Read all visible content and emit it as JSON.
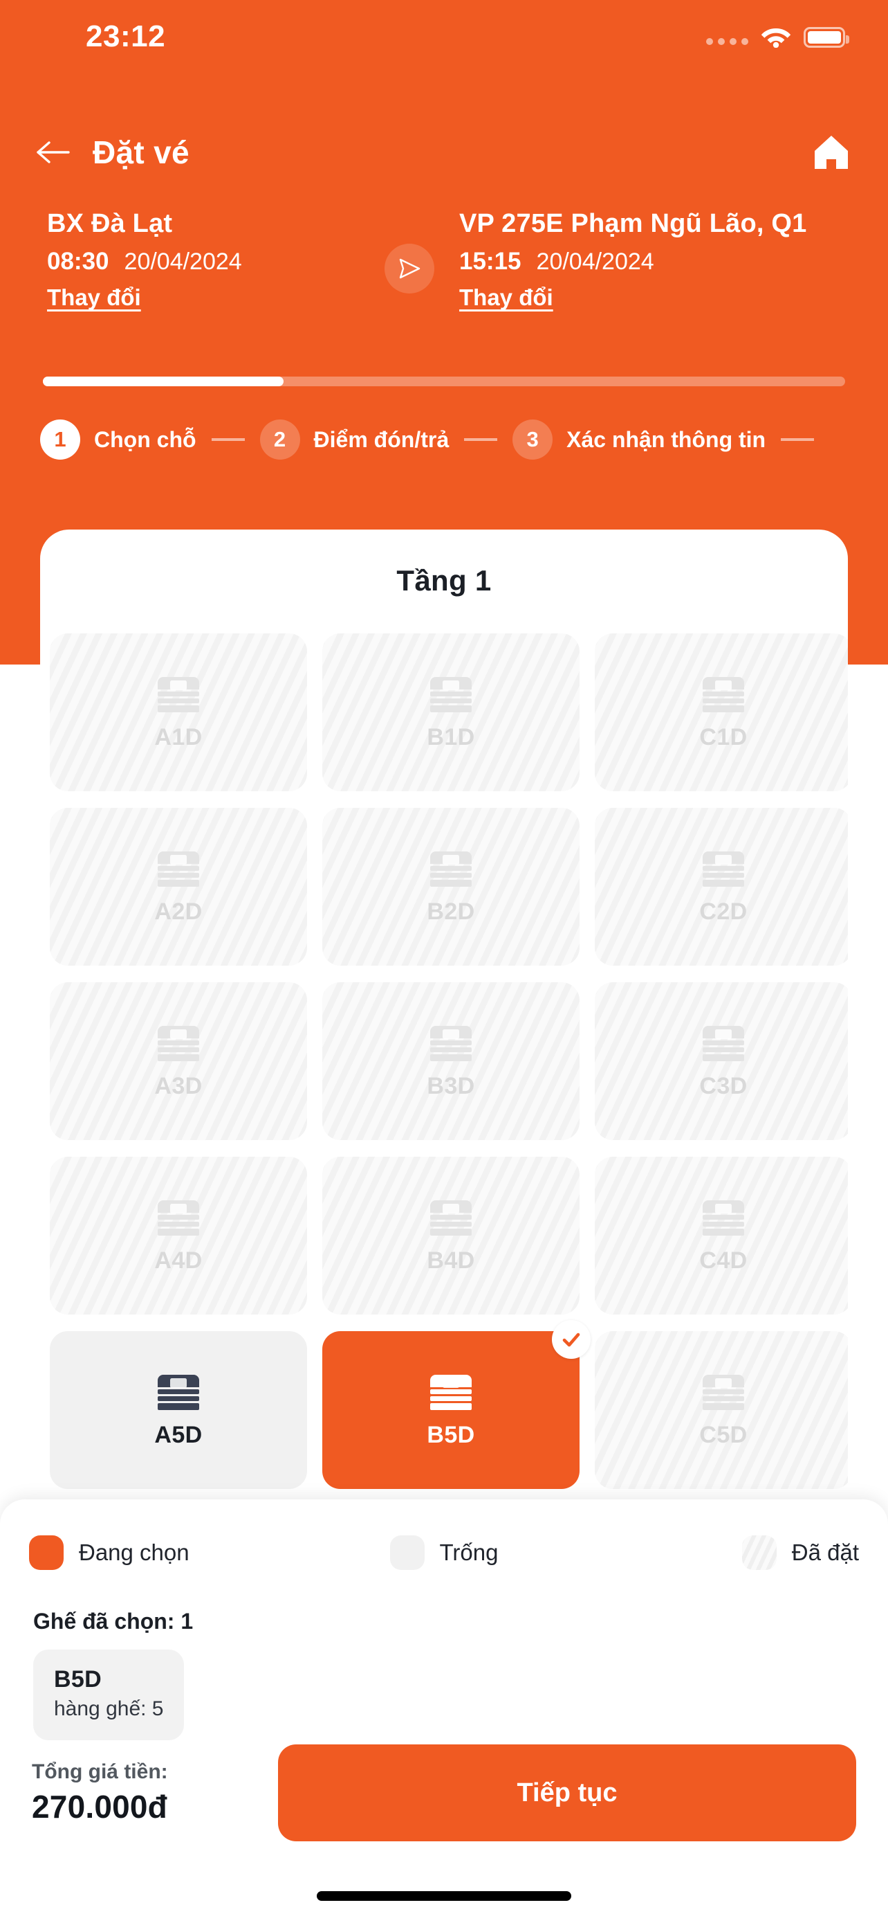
{
  "statusbar": {
    "time": "23:12",
    "cellular_icon": "signal-dots-icon",
    "wifi_icon": "wifi-icon",
    "battery_icon": "battery-full-icon"
  },
  "navbar": {
    "back_icon": "arrow-left-icon",
    "title": "Đặt vé",
    "home_icon": "home-icon"
  },
  "trip": {
    "from": {
      "place": "BX Đà Lạt",
      "time": "08:30",
      "date": "20/04/2024",
      "change_label": "Thay đổi"
    },
    "to": {
      "place": "VP 275E Phạm Ngũ Lão, Q1",
      "time": "15:15",
      "date": "20/04/2024",
      "change_label": "Thay đổi"
    },
    "direction_icon": "send-arrow-icon"
  },
  "progress": {
    "percent": 30
  },
  "steps": [
    {
      "num": "1",
      "label": "Chọn chỗ",
      "state": "active"
    },
    {
      "num": "2",
      "label": "Điểm đón/trả",
      "state": "idle"
    },
    {
      "num": "3",
      "label": "Xác nhận thông tin",
      "state": "idle"
    }
  ],
  "seatmap": {
    "floor_title": "Tầng 1",
    "seat_icon": "bed-icon",
    "check_icon": "check-circle-icon",
    "seats": [
      {
        "code": "A1D",
        "state": "taken"
      },
      {
        "code": "B1D",
        "state": "taken"
      },
      {
        "code": "C1D",
        "state": "taken"
      },
      {
        "code": "A2D",
        "state": "taken"
      },
      {
        "code": "B2D",
        "state": "taken"
      },
      {
        "code": "C2D",
        "state": "taken"
      },
      {
        "code": "A3D",
        "state": "taken"
      },
      {
        "code": "B3D",
        "state": "taken"
      },
      {
        "code": "C3D",
        "state": "taken"
      },
      {
        "code": "A4D",
        "state": "taken"
      },
      {
        "code": "B4D",
        "state": "taken"
      },
      {
        "code": "C4D",
        "state": "taken"
      },
      {
        "code": "A5D",
        "state": "free"
      },
      {
        "code": "B5D",
        "state": "sel"
      },
      {
        "code": "C5D",
        "state": "taken"
      }
    ]
  },
  "legend": [
    {
      "key": "sel",
      "label": "Đang chọn"
    },
    {
      "key": "free",
      "label": "Trống"
    },
    {
      "key": "taken",
      "label": "Đã đặt"
    }
  ],
  "selection": {
    "title": "Ghế đã chọn: 1",
    "chips": [
      {
        "code": "B5D",
        "row": "hàng ghế: 5"
      }
    ]
  },
  "footer": {
    "total_label": "Tổng giá tiền:",
    "total_value": "270.000đ",
    "cta_label": "Tiếp tục"
  },
  "colors": {
    "accent": "#F05A22",
    "seat_free_bg": "#F1F1F1",
    "seat_taken_text": "#D9D9D9",
    "text_dark": "#1b1f26"
  }
}
